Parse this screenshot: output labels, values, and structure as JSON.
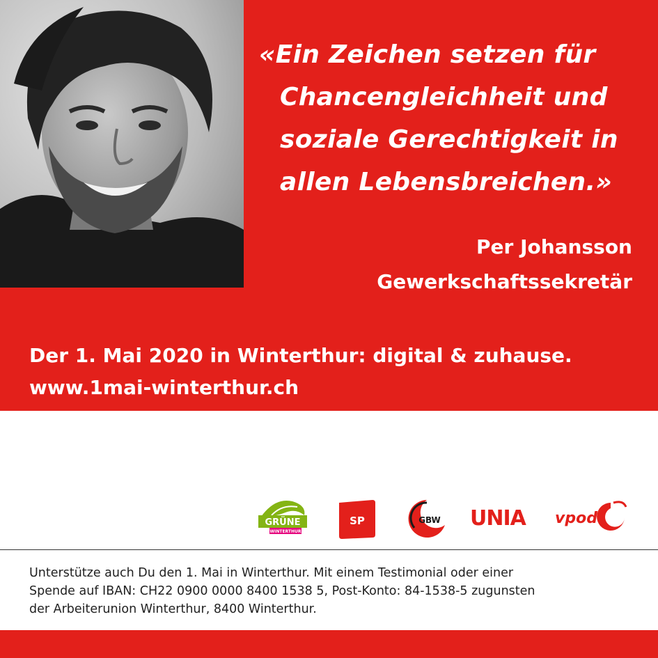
{
  "quote": {
    "lines": [
      "«Ein Zeichen setzen für",
      "Chancengleichheit und",
      "soziale Gerechtigkeit in",
      "allen Lebensbreichen.»"
    ]
  },
  "author": {
    "name": "Per Johansson",
    "role": "Gewerkschaftssekretär"
  },
  "event": {
    "headline": "Der 1. Mai 2020 in Winterthur: digital & zuhause.",
    "url": "www.1mai-winterthur.ch"
  },
  "logos": {
    "gruene": {
      "icon": "gruene-logo",
      "text": "GRÜNE",
      "sub": "WINTERTHUR",
      "color": "#84b414",
      "accent": "#e5007d"
    },
    "sp": {
      "icon": "sp-logo",
      "text": "SP",
      "color": "#e3201b"
    },
    "gbw": {
      "icon": "gbw-logo",
      "text": "GBW",
      "color": "#e3201b"
    },
    "unia": {
      "icon": "unia-logo",
      "text": "UNIA",
      "color": "#e3201b"
    },
    "vpod": {
      "icon": "vpod-logo",
      "text": "vpod",
      "color": "#e3201b"
    }
  },
  "footer": {
    "lines": [
      "Unterstütze auch Du den 1. Mai in Winterthur. Mit einem Testimonial oder einer",
      "Spende auf IBAN: CH22 0900 0000 8400 1538 5, Post-Konto: 84-1538-5 zugunsten",
      "der Arbeiterunion Winterthur, 8400 Winterthur."
    ]
  },
  "colors": {
    "brand_red": "#e3201b",
    "text_white": "#ffffff",
    "text_dark": "#222222"
  }
}
